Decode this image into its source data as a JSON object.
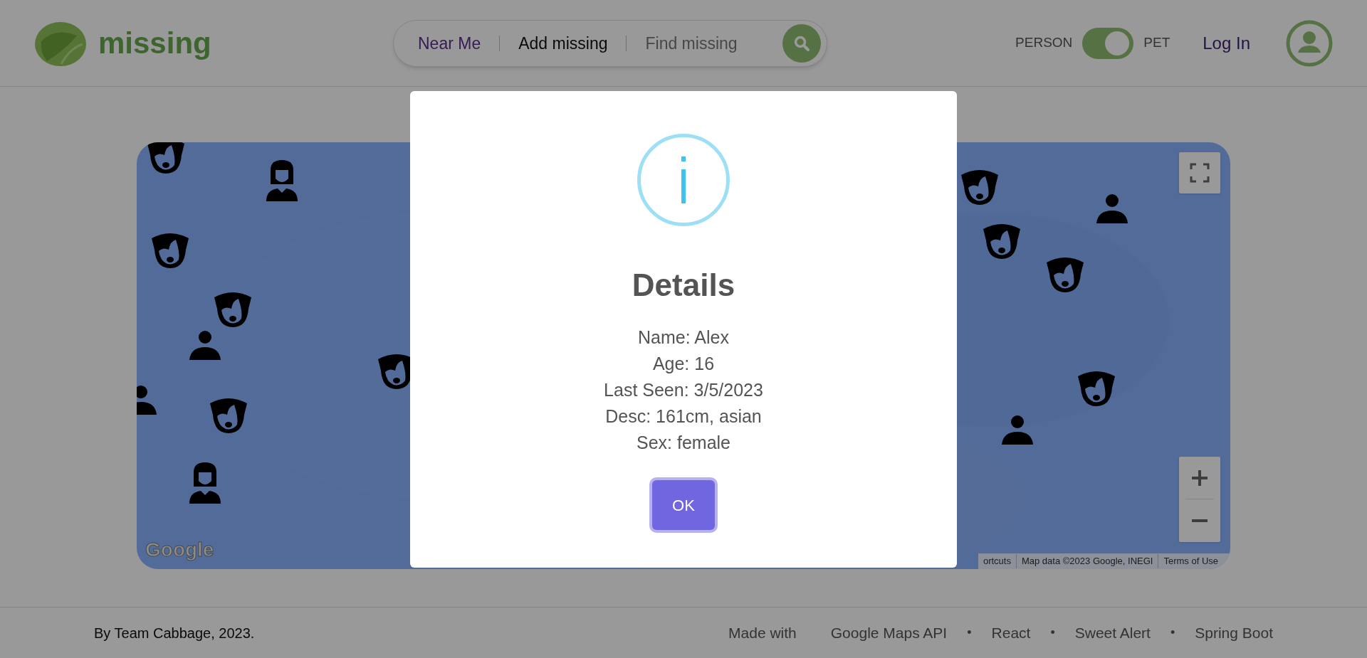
{
  "header": {
    "logo_text": "missing",
    "nav": [
      {
        "label": "Near Me"
      },
      {
        "label": "Add missing"
      },
      {
        "label": "Find missing"
      }
    ],
    "toggle": {
      "left_label": "PERSON",
      "right_label": "PET",
      "on": true
    },
    "login": "Log In"
  },
  "map": {
    "logo": "Google",
    "attribution": [
      "ortcuts",
      "Map data ©2023 Google, INEGI",
      "Terms of Use"
    ]
  },
  "dialog": {
    "title": "Details",
    "lines": [
      "Name: Alex",
      "Age: 16",
      "Last Seen: 3/5/2023",
      "Desc: 161cm, asian",
      "Sex: female"
    ],
    "button": "OK"
  },
  "footer": {
    "credit": "By Team Cabbage, 2023.",
    "items": [
      {
        "kind": "label",
        "text": "Made with"
      },
      {
        "kind": "link",
        "text": "Google Maps API"
      },
      {
        "kind": "separator",
        "text": "•"
      },
      {
        "kind": "link",
        "text": "React"
      },
      {
        "kind": "separator",
        "text": "•"
      },
      {
        "kind": "link",
        "text": "Sweet Alert"
      },
      {
        "kind": "separator",
        "text": "•"
      },
      {
        "kind": "link",
        "text": "Spring Boot"
      }
    ]
  }
}
